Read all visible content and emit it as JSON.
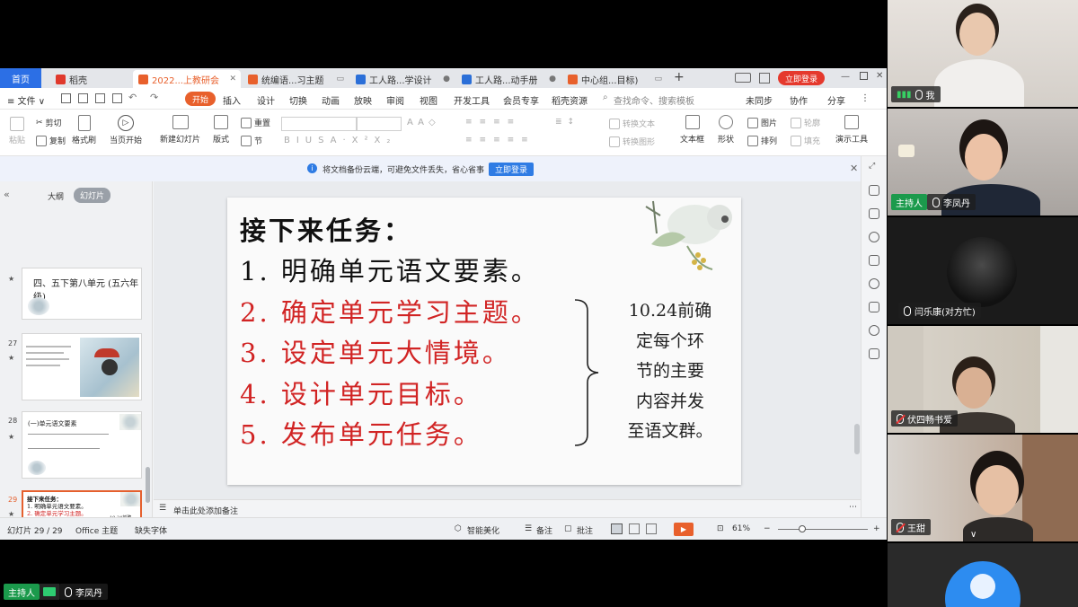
{
  "tabs": [
    {
      "label": "首页",
      "kind": "home"
    },
    {
      "label": "稻壳",
      "icon_color": "#e0392c"
    },
    {
      "label": "2022...上教研会",
      "icon_color": "#e8602c",
      "active": true
    },
    {
      "label": "统编语...习主题",
      "icon_color": "#e8602c"
    },
    {
      "label": "工人路...学设计",
      "icon_color": "#2b6fd8"
    },
    {
      "label": "工人路...动手册",
      "icon_color": "#2b6fd8"
    },
    {
      "label": "中心组...目标)",
      "icon_color": "#e8602c"
    }
  ],
  "window": {
    "login_label": "立即登录",
    "new_tab": "+"
  },
  "menu": {
    "file": "≡ 文件 ∨",
    "start": "开始",
    "items": [
      "插入",
      "设计",
      "切换",
      "动画",
      "放映",
      "审阅",
      "视图",
      "开发工具",
      "会员专享",
      "稻壳资源"
    ],
    "search": "查找命令、搜索模板",
    "right": [
      "未同步",
      "协作",
      "分享"
    ]
  },
  "ribbon": {
    "paste": "粘贴",
    "cut": "剪切",
    "copy": "复制",
    "format_painter": "格式刷",
    "from_current": "当页开始",
    "new_slide": "新建幻灯片",
    "layout": "版式",
    "section": "节",
    "reset": "重置",
    "textbox": "文本框",
    "shape": "形状",
    "picture": "图片",
    "arrange": "排列",
    "fill": "填充",
    "outline": "轮廓",
    "convert_text": "转换文本",
    "convert_graphic": "转换图形",
    "present_tools": "演示工具"
  },
  "notice": {
    "text": "将文档备份云端，可避免文件丢失，省心省事",
    "button": "立即登录"
  },
  "panel": {
    "tab_outline": "大纲",
    "tab_slides": "幻灯片",
    "add": "+"
  },
  "thumbnails": [
    {
      "num": "",
      "text": "四、五下第八单元 (五六年级)"
    },
    {
      "num": "27",
      "text": ""
    },
    {
      "num": "28",
      "text": "(一)单元语文要素"
    },
    {
      "num": "29",
      "text": "接下来任务：",
      "selected": true
    }
  ],
  "slide": {
    "heading": "接下来任务：",
    "items": [
      "1. 明确单元语文要素。",
      "2. 确定单元学习主题。",
      "3. 设定单元大情境。",
      "4. 设计单元目标。",
      "5. 发布单元任务。"
    ],
    "side_note": [
      "10.24前确",
      "定每个环",
      "节的主要",
      "内容并发",
      "至语文群。"
    ]
  },
  "notes_placeholder": "单击此处添加备注",
  "status": {
    "slide_pos": "幻灯片 29 / 29",
    "theme": "Office 主题",
    "missing_font": "缺失字体",
    "beautify": "智能美化",
    "notes": "备注",
    "comments": "批注",
    "zoom": "61%"
  },
  "participants": [
    {
      "name": "我",
      "host": false
    },
    {
      "name": "李凤丹",
      "host": true,
      "host_label": "主持人"
    },
    {
      "name": "闫乐康(对方忙)",
      "host": false
    },
    {
      "name": "伏四畅书爱",
      "host": false
    },
    {
      "name": "王甜",
      "host": false
    },
    {
      "name": "",
      "host": false
    }
  ],
  "bottom_bar": {
    "host_label": "主持人",
    "name": "李凤丹"
  }
}
